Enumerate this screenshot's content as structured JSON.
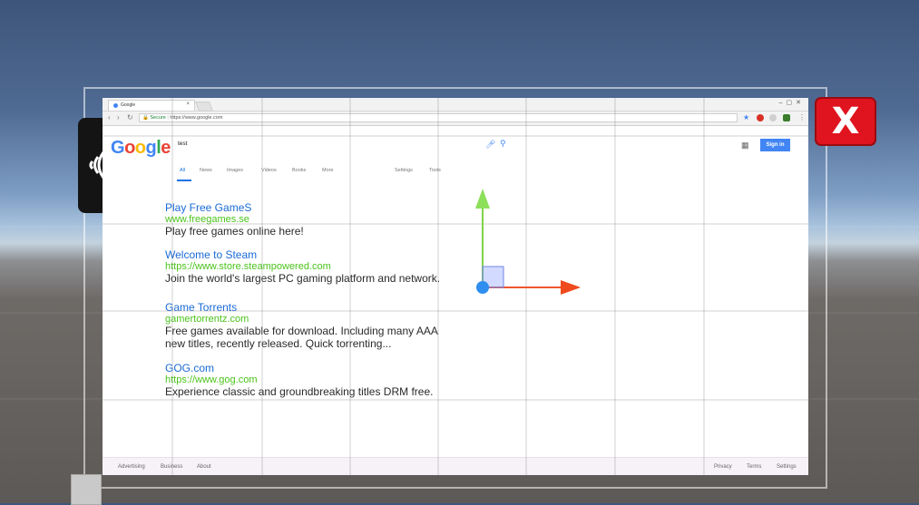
{
  "scene": {
    "close_button_label": "X",
    "accent_color": "#e0141e"
  },
  "browser": {
    "tab_title": "Google",
    "tab_close": "×",
    "window_controls": "–▢✕",
    "address": {
      "secure_label": "Secure",
      "url": "https://www.google.com"
    },
    "google": {
      "search_query": "test",
      "signin_label": "Sign in",
      "tabs": [
        "All",
        "News",
        "Images",
        "Videos",
        "Books",
        "More"
      ],
      "tools": [
        "Settings",
        "Tools"
      ]
    },
    "results": [
      {
        "title": "Play Free GameS",
        "url": "www.freegames.se",
        "snippet": [
          "Play free games online here!"
        ]
      },
      {
        "title": "Welcome to Steam",
        "url": "https://www.store.steampowered.com",
        "snippet": [
          "Join the world's largest PC gaming platform and network."
        ]
      },
      {
        "title": "Game Torrents",
        "url": "gamertorrentz.com",
        "snippet": [
          "Free games available for download. Including many AAA",
          "new titles, recently released. Quick torrenting..."
        ]
      },
      {
        "title": "GOG.com",
        "url": "https://www.gog.com",
        "snippet": [
          "Experience classic and groundbreaking titles DRM free."
        ]
      }
    ],
    "footer": {
      "left": [
        "Advertising",
        "Business",
        "About"
      ],
      "right": [
        "Privacy",
        "Terms",
        "Settings"
      ]
    }
  }
}
